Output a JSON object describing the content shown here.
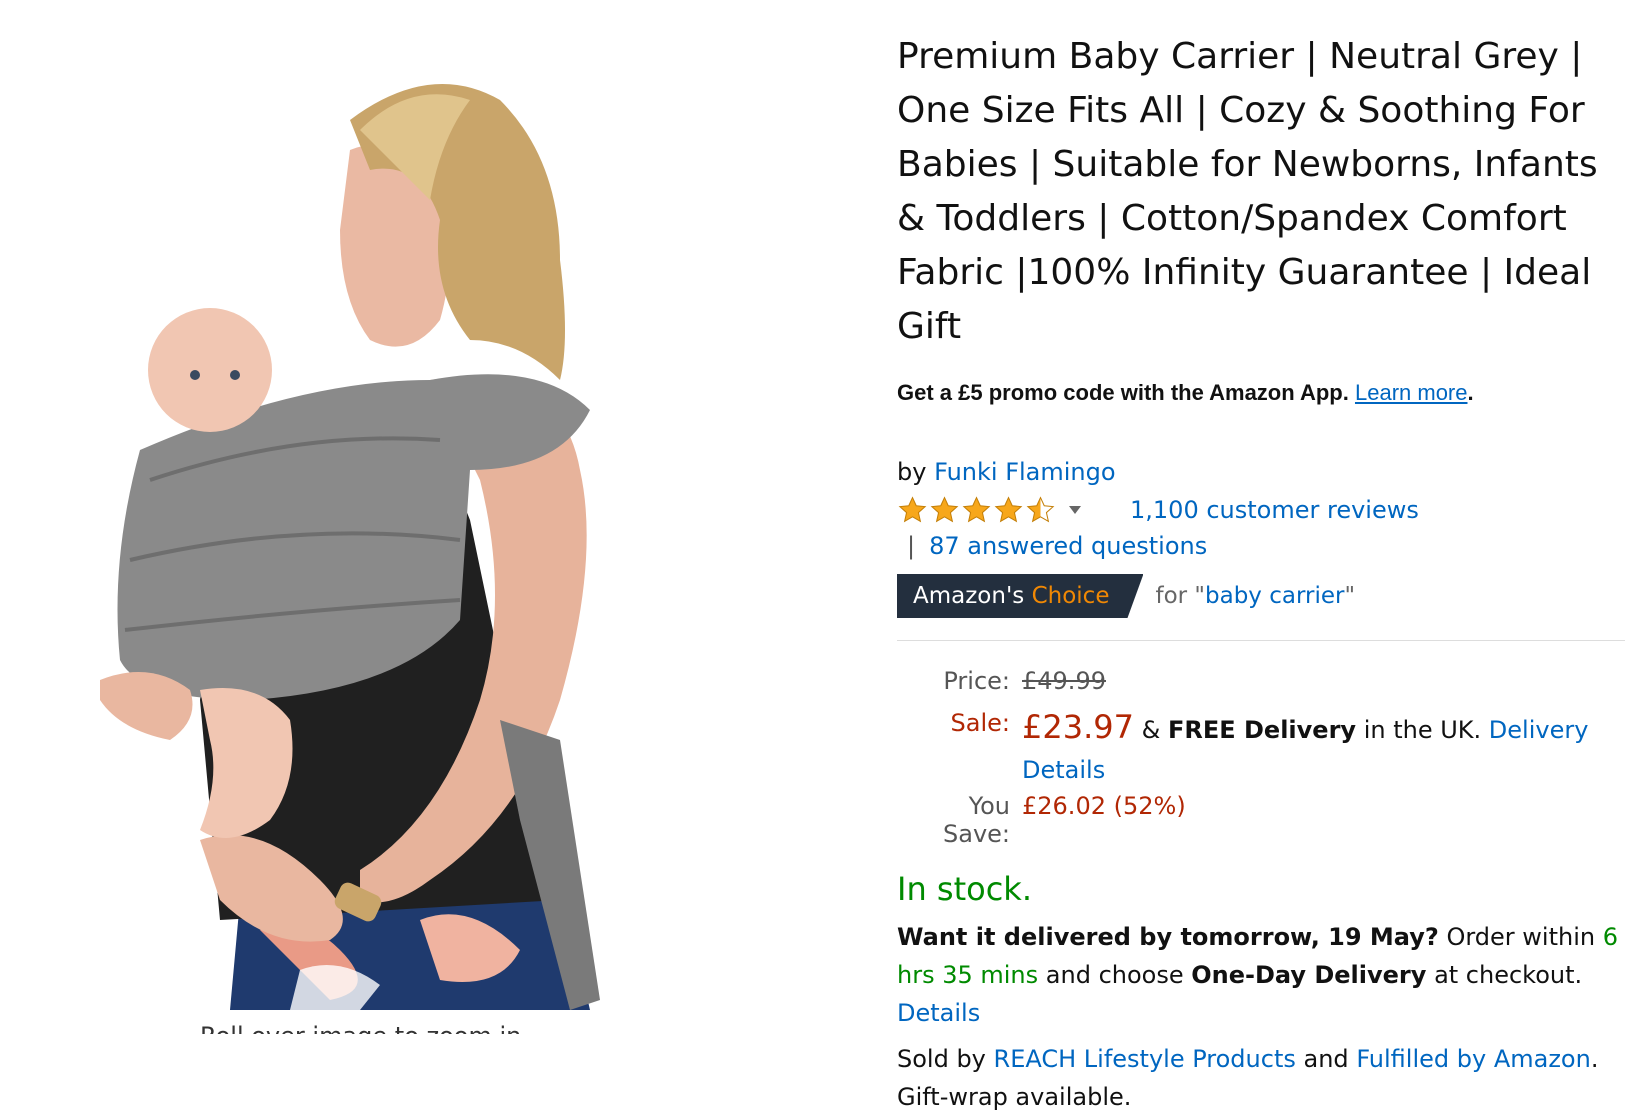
{
  "product": {
    "title": "Premium Baby Carrier | Neutral Grey | One Size Fits All | Cozy & Soothing For Babies | Suitable for Newborns, Infants & Toddlers | Cotton/Spandex Comfort Fabric |100% Infinity Guarantee | Ideal Gift",
    "image_caption": "Roll over image to zoom in"
  },
  "promo": {
    "text": "Get a £5 promo code with the Amazon App.",
    "link": "Learn more",
    "end": "."
  },
  "byline": {
    "prefix": "by",
    "brand": "Funki Flamingo"
  },
  "rating": {
    "stars": 4.5,
    "reviews": "1,100 customer reviews",
    "pipe": "|",
    "questions": "87 answered questions",
    "star_color": "#f7a71b"
  },
  "choice": {
    "badge_part1": "Amazon's",
    "badge_part2": "Choice",
    "for_prefix": "for",
    "quote_open": "\"",
    "keyword": "baby carrier",
    "quote_close": "\""
  },
  "price": {
    "price_label": "Price:",
    "list_price": "£49.99",
    "sale_label": "Sale:",
    "sale_price": "£23.97",
    "delivery_and": "&",
    "free_delivery": "FREE Delivery",
    "delivery_where": "in the UK.",
    "delivery_details": "Delivery Details",
    "save_label": "You Save:",
    "save_value": "£26.02 (52%)"
  },
  "availability": {
    "stock": "In stock.",
    "want_bold": "Want it delivered by tomorrow, 19 May?",
    "order_within": "Order within",
    "countdown": "6 hrs 35 mins",
    "and_choose": "and choose",
    "one_day": "One-Day Delivery",
    "at_checkout": "at checkout.",
    "details_link": "Details"
  },
  "seller": {
    "sold_by": "Sold by",
    "seller_name": "REACH Lifestyle Products",
    "and": "and",
    "fulfilled": "Fulfilled by Amazon",
    "end": ".",
    "giftwrap": "Gift-wrap available."
  },
  "colors": {
    "link": "#0066c0",
    "price_red": "#b12704",
    "stock_green": "#008a00",
    "badge_bg": "#232f3e",
    "badge_orange": "#f08804"
  }
}
